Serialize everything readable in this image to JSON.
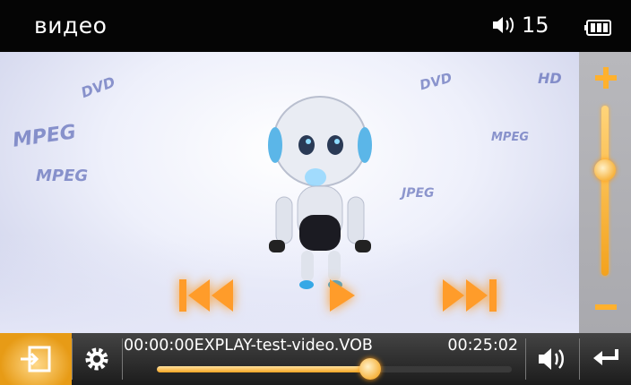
{
  "header": {
    "title": "видео",
    "volume_value": "15"
  },
  "icons": {
    "speaker": "speaker-icon",
    "battery": "battery-icon",
    "input": "input-source-icon",
    "gear": "gear-icon",
    "volume_button": "volume-icon",
    "back": "back-arrow-icon",
    "prev": "previous-track-icon",
    "play": "play-icon",
    "next": "next-track-icon"
  },
  "player": {
    "current_time": "00:00:00",
    "filename": "EXPLAY-test-video.VOB",
    "total_time": "00:25:02",
    "progress_fraction": 0.6
  },
  "volume_panel": {
    "level_fraction": 0.62
  },
  "background_logos": [
    "MPEG",
    "DVD",
    "HD",
    "MPEG",
    "DVD",
    "MPEG",
    "JPEG"
  ],
  "colors": {
    "accent": "#f6a623",
    "topbar": "#050505",
    "bottombar": "#2a2a2a"
  }
}
